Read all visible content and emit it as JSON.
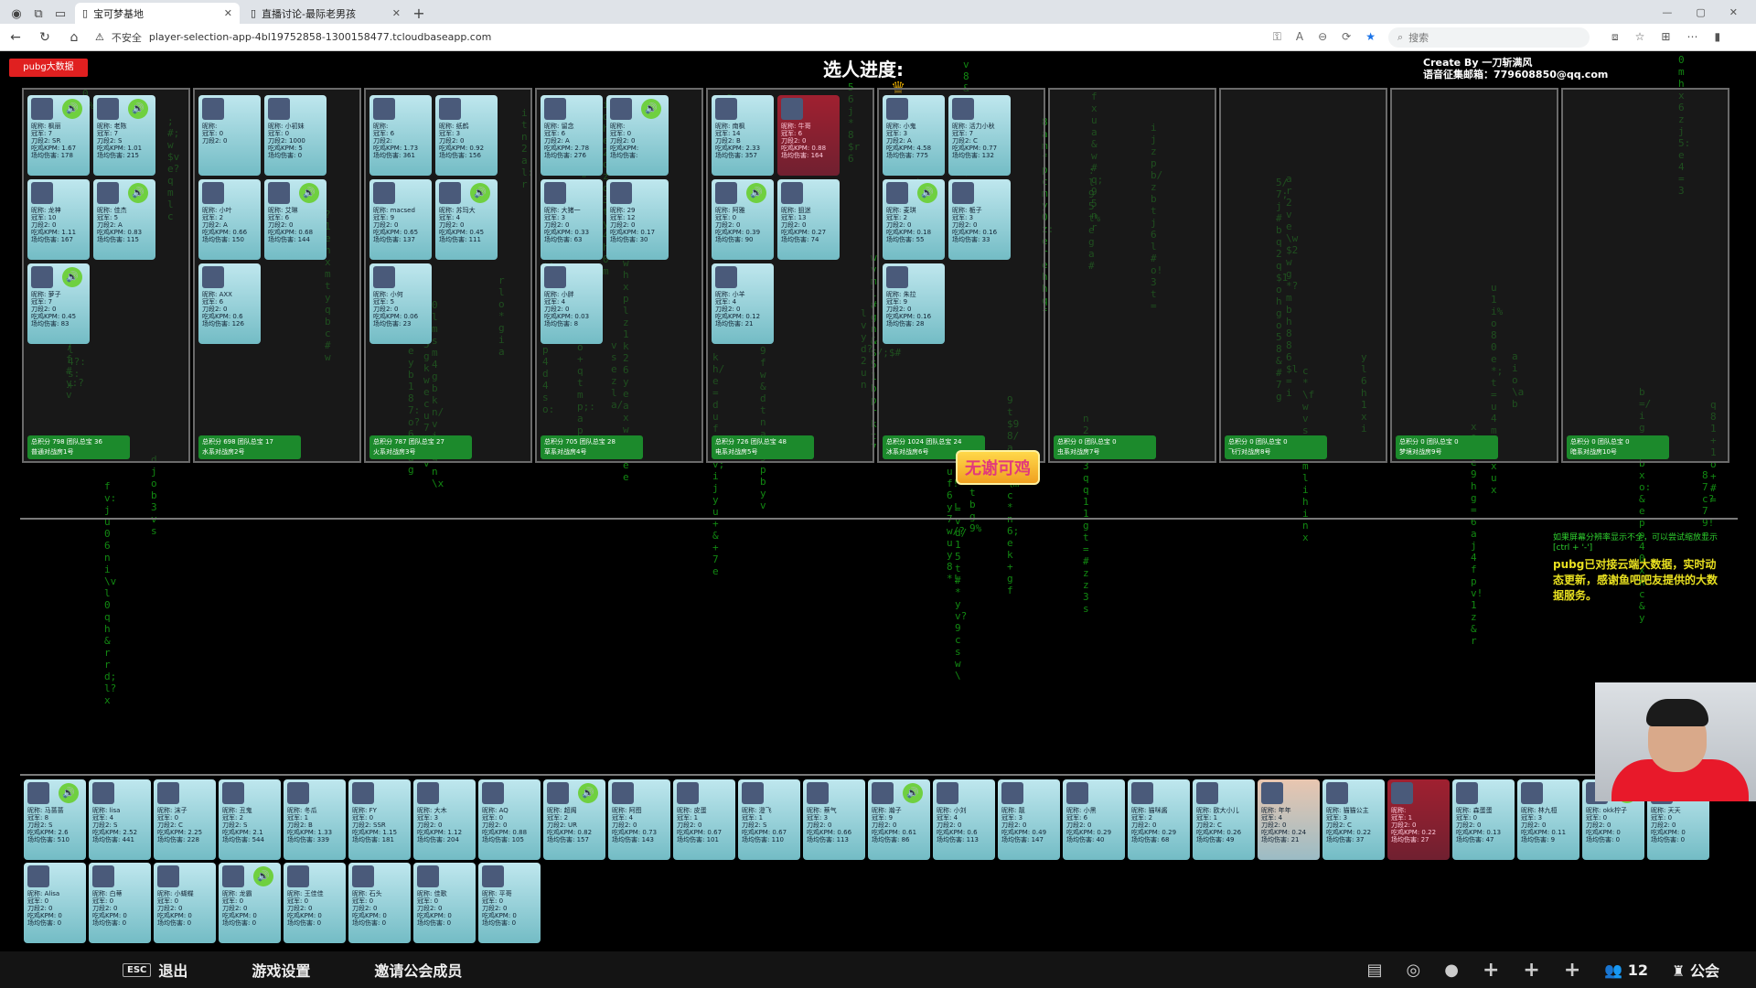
{
  "browser": {
    "tabs": [
      {
        "title": "宝可梦基地"
      },
      {
        "title": "直播讨论-最际老男孩"
      }
    ],
    "insecure": "不安全",
    "url": "player-selection-app-4bl19752858-1300158477.tcloudbaseapp.com",
    "search_placeholder": "搜索"
  },
  "header": {
    "data_button": "pubg大数据",
    "title": "选人进度:",
    "credit_line1": "Create By 一刀斩满风",
    "credit_line2": "语音征集邮箱：779608850@qq.com"
  },
  "rooms": [
    {
      "footer": "总积分 798 团队总宝 36",
      "name": "普通对战房1号",
      "cards": [
        {
          "nick": "昵称: 枫丽",
          "cj": "冠军: 7",
          "rank": "刀段2: SR",
          "kpm": "吃鸡KPM: 1.67",
          "dmg": "场均伤害: 178",
          "spk": true
        },
        {
          "nick": "昵称: 老陈",
          "cj": "冠军: 7",
          "rank": "刀段2: S",
          "kpm": "吃鸡KPM: 1.01",
          "dmg": "场均伤害: 215",
          "spk": true
        },
        {
          "nick": "昵称: 龙神",
          "cj": "冠军: 10",
          "rank": "刀段2: 0",
          "kpm": "吃鸡KPM: 1.11",
          "dmg": "场均伤害: 167",
          "spk": false
        },
        {
          "nick": "昵称: 佳杰",
          "cj": "冠军: 5",
          "rank": "刀段2: A",
          "kpm": "吃鸡KPM: 0.83",
          "dmg": "场均伤害: 115",
          "spk": true
        },
        {
          "nick": "昵称: 萝子",
          "cj": "冠军: 7",
          "rank": "刀段2: 0",
          "kpm": "吃鸡KPM: 0.45",
          "dmg": "场均伤害: 83",
          "spk": true
        }
      ]
    },
    {
      "footer": "总积分 698 团队总宝 17",
      "name": "水系对战房2号",
      "cards": [
        {
          "nick": "昵称: ",
          "cj": "冠军: 0",
          "rank": "刀段2: 0",
          "kpm": "",
          "dmg": "",
          "spk": false
        },
        {
          "nick": "昵称: 小初妹",
          "cj": "冠军: 0",
          "rank": "刀段2: 1000",
          "kpm": "吃鸡KPM: 5",
          "dmg": "场均伤害: 0",
          "spk": false
        },
        {
          "nick": "昵称: 小叶",
          "cj": "冠军: 2",
          "rank": "刀段2: A",
          "kpm": "吃鸡KPM: 0.66",
          "dmg": "场均伤害: 150",
          "spk": false
        },
        {
          "nick": "昵称: 艾琳",
          "cj": "冠军: 6",
          "rank": "刀段2: 0",
          "kpm": "吃鸡KPM: 0.68",
          "dmg": "场均伤害: 144",
          "spk": true
        },
        {
          "nick": "昵称: AXX",
          "cj": "冠军: 6",
          "rank": "刀段2: 0",
          "kpm": "吃鸡KPM: 0.6",
          "dmg": "场均伤害: 126",
          "spk": false
        }
      ]
    },
    {
      "footer": "总积分 787 团队总宝 27",
      "name": "火系对战房3号",
      "cards": [
        {
          "nick": "昵称: ",
          "cj": "冠军: 6",
          "rank": "刀段2: ",
          "kpm": "吃鸡KPM: 1.73",
          "dmg": "场均伤害: 361",
          "spk": false
        },
        {
          "nick": "昵称: 纸鹤",
          "cj": "冠军: 3",
          "rank": "刀段2: 0",
          "kpm": "吃鸡KPM: 0.92",
          "dmg": "场均伤害: 156",
          "spk": false
        },
        {
          "nick": "昵称: macsed",
          "cj": "冠军: 9",
          "rank": "刀段2: 0",
          "kpm": "吃鸡KPM: 0.65",
          "dmg": "场均伤害: 137",
          "spk": false
        },
        {
          "nick": "昵称: 苏玛大",
          "cj": "冠军: 4",
          "rank": "刀段2: 0",
          "kpm": "吃鸡KPM: 0.45",
          "dmg": "场均伤害: 111",
          "spk": true
        },
        {
          "nick": "昵称: 小何",
          "cj": "冠军: 5",
          "rank": "刀段2: 0",
          "kpm": "吃鸡KPM: 0.06",
          "dmg": "场均伤害: 23",
          "spk": false
        }
      ]
    },
    {
      "footer": "总积分 705 团队总宝 28",
      "name": "草系对战房4号",
      "cards": [
        {
          "nick": "昵称: 留念",
          "cj": "冠军: 6",
          "rank": "刀段2: A",
          "kpm": "吃鸡KPM: 2.78",
          "dmg": "场均伤害: 276",
          "spk": false
        },
        {
          "nick": "昵称: ",
          "cj": "冠军: 0",
          "rank": "刀段2: 0",
          "kpm": "吃鸡KPM: ",
          "dmg": "场均伤害: ",
          "spk": true
        },
        {
          "nick": "昵称: 大猪一",
          "cj": "冠军: 3",
          "rank": "刀段2: 0",
          "kpm": "吃鸡KPM: 0.33",
          "dmg": "场均伤害: 63",
          "spk": false
        },
        {
          "nick": "昵称: 29",
          "cj": "冠军: 12",
          "rank": "刀段2: 0",
          "kpm": "吃鸡KPM: 0.17",
          "dmg": "场均伤害: 30",
          "spk": false
        },
        {
          "nick": "昵称: 小胖",
          "cj": "冠军: 4",
          "rank": "刀段2: 0",
          "kpm": "吃鸡KPM: 0.03",
          "dmg": "场均伤害: 8",
          "spk": false
        }
      ]
    },
    {
      "footer": "总积分 726 团队总宝 48",
      "name": "电系对战房5号",
      "cards": [
        {
          "nick": "昵称: 南枫",
          "cj": "冠军: 14",
          "rank": "刀段2: B",
          "kpm": "吃鸡KPM: 2.33",
          "dmg": "场均伤害: 357",
          "spk": false
        },
        {
          "nick": "昵称: 牛哥",
          "cj": "冠军: 6",
          "rank": "刀段2: 0",
          "kpm": "吃鸡KPM: 0.88",
          "dmg": "场均伤害: 164",
          "spk": false,
          "red": true
        },
        {
          "nick": "昵称: 阿雅",
          "cj": "冠军: 0",
          "rank": "刀段2: 0",
          "kpm": "吃鸡KPM: 0.39",
          "dmg": "场均伤害: 90",
          "spk": true
        },
        {
          "nick": "昵称: 狙迷",
          "cj": "冠军: 13",
          "rank": "刀段2: 0",
          "kpm": "吃鸡KPM: 0.27",
          "dmg": "场均伤害: 74",
          "spk": false
        },
        {
          "nick": "昵称: 小羊",
          "cj": "冠军: 4",
          "rank": "刀段2: 0",
          "kpm": "吃鸡KPM: 0.12",
          "dmg": "场均伤害: 21",
          "spk": false
        }
      ]
    },
    {
      "footer": "总积分 1024 团队总宝 24",
      "name": "冰系对战房6号",
      "cards": [
        {
          "nick": "昵称: 小鬼",
          "cj": "冠军: 3",
          "rank": "刀段2: A",
          "kpm": "吃鸡KPM: 4.58",
          "dmg": "场均伤害: 775",
          "spk": false
        },
        {
          "nick": "昵称: 活力小秋",
          "cj": "冠军: 7",
          "rank": "刀段2: C",
          "kpm": "吃鸡KPM: 0.77",
          "dmg": "场均伤害: 132",
          "spk": false
        },
        {
          "nick": "昵称: 麦琪",
          "cj": "冠军: 2",
          "rank": "刀段2: 0",
          "kpm": "吃鸡KPM: 0.18",
          "dmg": "场均伤害: 55",
          "spk": true
        },
        {
          "nick": "昵称: 栀子",
          "cj": "冠军: 3",
          "rank": "刀段2: 0",
          "kpm": "吃鸡KPM: 0.16",
          "dmg": "场均伤害: 33",
          "spk": false
        },
        {
          "nick": "昵称: 朱拉",
          "cj": "冠军: 9",
          "rank": "刀段2: 0",
          "kpm": "吃鸡KPM: 0.16",
          "dmg": "场均伤害: 28",
          "spk": false
        }
      ]
    },
    {
      "footer": "总积分 0 团队总宝 0",
      "name": "虫系对战房7号",
      "cards": []
    },
    {
      "footer": "总积分 0 团队总宝 0",
      "name": "飞行对战房8号",
      "cards": []
    },
    {
      "footer": "总积分 0 团队总宝 0",
      "name": "梦境对战房9号",
      "cards": []
    },
    {
      "footer": "总积分 0 团队总宝 0",
      "name": "暗系对战房10号",
      "cards": []
    }
  ],
  "badge": "无谢可鸡",
  "notice": {
    "small": "如果屏幕分辨率显示不全，可以尝试缩放显示[ctrl + '-']",
    "big": "pubg已对接云端大数据，实时动态更新，感谢鱼吧吧友提供的大数据服务。"
  },
  "pool": [
    {
      "nick": "昵称: 马蔷蔷",
      "cj": "冠军: 8",
      "rank": "刀段2: S",
      "kpm": "吃鸡KPM: 2.6",
      "dmg": "场均伤害: 510",
      "spk": true
    },
    {
      "nick": "昵称: lisa",
      "cj": "冠军: 4",
      "rank": "刀段2: S",
      "kpm": "吃鸡KPM: 2.52",
      "dmg": "场均伤害: 441",
      "spk": false
    },
    {
      "nick": "昵称: 沫子",
      "cj": "冠军: 0",
      "rank": "刀段2: C",
      "kpm": "吃鸡KPM: 2.25",
      "dmg": "场均伤害: 228",
      "spk": false
    },
    {
      "nick": "昵称: 丑鬼",
      "cj": "冠军: 2",
      "rank": "刀段2: S",
      "kpm": "吃鸡KPM: 2.1",
      "dmg": "场均伤害: 544",
      "spk": false
    },
    {
      "nick": "昵称: 冬瓜",
      "cj": "冠军: 1",
      "rank": "刀段2: B",
      "kpm": "吃鸡KPM: 1.33",
      "dmg": "场均伤害: 339",
      "spk": false
    },
    {
      "nick": "昵称: FY",
      "cj": "冠军: 0",
      "rank": "刀段2: SSR",
      "kpm": "吃鸡KPM: 1.15",
      "dmg": "场均伤害: 181",
      "spk": false
    },
    {
      "nick": "昵称: 大木",
      "cj": "冠军: 3",
      "rank": "刀段2: 0",
      "kpm": "吃鸡KPM: 1.12",
      "dmg": "场均伤害: 204",
      "spk": false
    },
    {
      "nick": "昵称: AQ",
      "cj": "冠军: 0",
      "rank": "刀段2: 0",
      "kpm": "吃鸡KPM: 0.88",
      "dmg": "场均伤害: 105",
      "spk": false
    },
    {
      "nick": "昵称: 超阁",
      "cj": "冠军: 2",
      "rank": "刀段2: UR",
      "kpm": "吃鸡KPM: 0.82",
      "dmg": "场均伤害: 157",
      "spk": true
    },
    {
      "nick": "昵称: 阿图",
      "cj": "冠军: 4",
      "rank": "刀段2: 0",
      "kpm": "吃鸡KPM: 0.73",
      "dmg": "场均伤害: 143",
      "spk": false
    },
    {
      "nick": "昵称: 皮蛋",
      "cj": "冠军: 1",
      "rank": "刀段2: 0",
      "kpm": "吃鸡KPM: 0.67",
      "dmg": "场均伤害: 101",
      "spk": false
    },
    {
      "nick": "昵称: 澄飞",
      "cj": "冠军: 1",
      "rank": "刀段2: S",
      "kpm": "吃鸡KPM: 0.67",
      "dmg": "场均伤害: 110",
      "spk": false
    },
    {
      "nick": "昵称: 蔡气",
      "cj": "冠军: 3",
      "rank": "刀段2: 0",
      "kpm": "吃鸡KPM: 0.66",
      "dmg": "场均伤害: 113",
      "spk": false
    },
    {
      "nick": "昵称: 瀚子",
      "cj": "冠军: 9",
      "rank": "刀段2: 0",
      "kpm": "吃鸡KPM: 0.61",
      "dmg": "场均伤害: 86",
      "spk": true
    },
    {
      "nick": "昵称: 小刘",
      "cj": "冠军: 4",
      "rank": "刀段2: 0",
      "kpm": "吃鸡KPM: 0.6",
      "dmg": "场均伤害: 113",
      "spk": false
    },
    {
      "nick": "昵称: 靓",
      "cj": "冠军: 3",
      "rank": "刀段2: 0",
      "kpm": "吃鸡KPM: 0.49",
      "dmg": "场均伤害: 147",
      "spk": false
    },
    {
      "nick": "昵称: 小黑",
      "cj": "冠军: 6",
      "rank": "刀段2: 0",
      "kpm": "吃鸡KPM: 0.29",
      "dmg": "场均伤害: 40",
      "spk": false
    },
    {
      "nick": "昵称: 猫咪酱",
      "cj": "冠军: 2",
      "rank": "刀段2: 0",
      "kpm": "吃鸡KPM: 0.29",
      "dmg": "场均伤害: 68",
      "spk": false
    },
    {
      "nick": "昵称: 欧大小儿",
      "cj": "冠军: 1",
      "rank": "刀段2: C",
      "kpm": "吃鸡KPM: 0.26",
      "dmg": "场均伤害: 49",
      "spk": false
    },
    {
      "nick": "昵称: 年年",
      "cj": "冠军: 4",
      "rank": "刀段2: 0",
      "kpm": "吃鸡KPM: 0.24",
      "dmg": "场均伤害: 21",
      "spk": false,
      "hl": true
    },
    {
      "nick": "昵称: 猫猫公主",
      "cj": "冠军: 3",
      "rank": "刀段2: C",
      "kpm": "吃鸡KPM: 0.22",
      "dmg": "场均伤害: 37",
      "spk": false
    },
    {
      "nick": "昵称: ",
      "cj": "冠军: 1",
      "rank": "刀段2: 0",
      "kpm": "吃鸡KPM: 0.22",
      "dmg": "场均伤害: 27",
      "spk": false,
      "red": true
    },
    {
      "nick": "昵称: 森蛋蛋",
      "cj": "冠军: 0",
      "rank": "刀段2: 0",
      "kpm": "吃鸡KPM: 0.13",
      "dmg": "场均伤害: 47",
      "spk": false
    },
    {
      "nick": "昵称: 林九桓",
      "cj": "冠军: 3",
      "rank": "刀段2: 0",
      "kpm": "吃鸡KPM: 0.11",
      "dmg": "场均伤害: 9",
      "spk": false
    },
    {
      "nick": "昵称: okk柠子",
      "cj": "冠军: 0",
      "rank": "刀段2: 0",
      "kpm": "吃鸡KPM: 0",
      "dmg": "场均伤害: 0",
      "spk": true
    },
    {
      "nick": "昵称: 天天",
      "cj": "冠军: 0",
      "rank": "刀段2: 0",
      "kpm": "吃鸡KPM: 0",
      "dmg": "场均伤害: 0",
      "spk": false
    },
    {
      "nick": "昵称: Alisa",
      "cj": "冠军: 0",
      "rank": "刀段2: 0",
      "kpm": "吃鸡KPM: 0",
      "dmg": "场均伤害: 0",
      "spk": false
    },
    {
      "nick": "昵称: 白蒂",
      "cj": "冠军: 0",
      "rank": "刀段2: 0",
      "kpm": "吃鸡KPM: 0",
      "dmg": "场均伤害: 0",
      "spk": false
    },
    {
      "nick": "昵称: 小蝴蝶",
      "cj": "冠军: 0",
      "rank": "刀段2: 0",
      "kpm": "吃鸡KPM: 0",
      "dmg": "场均伤害: 0",
      "spk": false
    },
    {
      "nick": "昵称: 龙霸",
      "cj": "冠军: 0",
      "rank": "刀段2: 0",
      "kpm": "吃鸡KPM: 0",
      "dmg": "场均伤害: 0",
      "spk": true
    },
    {
      "nick": "昵称: 王佳佳",
      "cj": "冠军: 0",
      "rank": "刀段2: 0",
      "kpm": "吃鸡KPM: 0",
      "dmg": "场均伤害: 0",
      "spk": false
    },
    {
      "nick": "昵称: 石头",
      "cj": "冠军: 0",
      "rank": "刀段2: 0",
      "kpm": "吃鸡KPM: 0",
      "dmg": "场均伤害: 0",
      "spk": false
    },
    {
      "nick": "昵称: 佳歌",
      "cj": "冠军: 0",
      "rank": "刀段2: 0",
      "kpm": "吃鸡KPM: 0",
      "dmg": "场均伤害: 0",
      "spk": false
    },
    {
      "nick": "昵称: 平哥",
      "cj": "冠军: 0",
      "rank": "刀段2: 0",
      "kpm": "吃鸡KPM: 0",
      "dmg": "场均伤害: 0",
      "spk": false
    }
  ],
  "taskbar": {
    "esc_key": "ESC",
    "exit": "退出",
    "settings": "游戏设置",
    "invite": "邀请公会成员",
    "count": "12",
    "guild": "公会"
  },
  "colors": {
    "accent_green": "#1c8a2c",
    "card_top": "#bfe7ee",
    "badge_text": "#e23a7a",
    "matrix": "#1ac21a"
  }
}
